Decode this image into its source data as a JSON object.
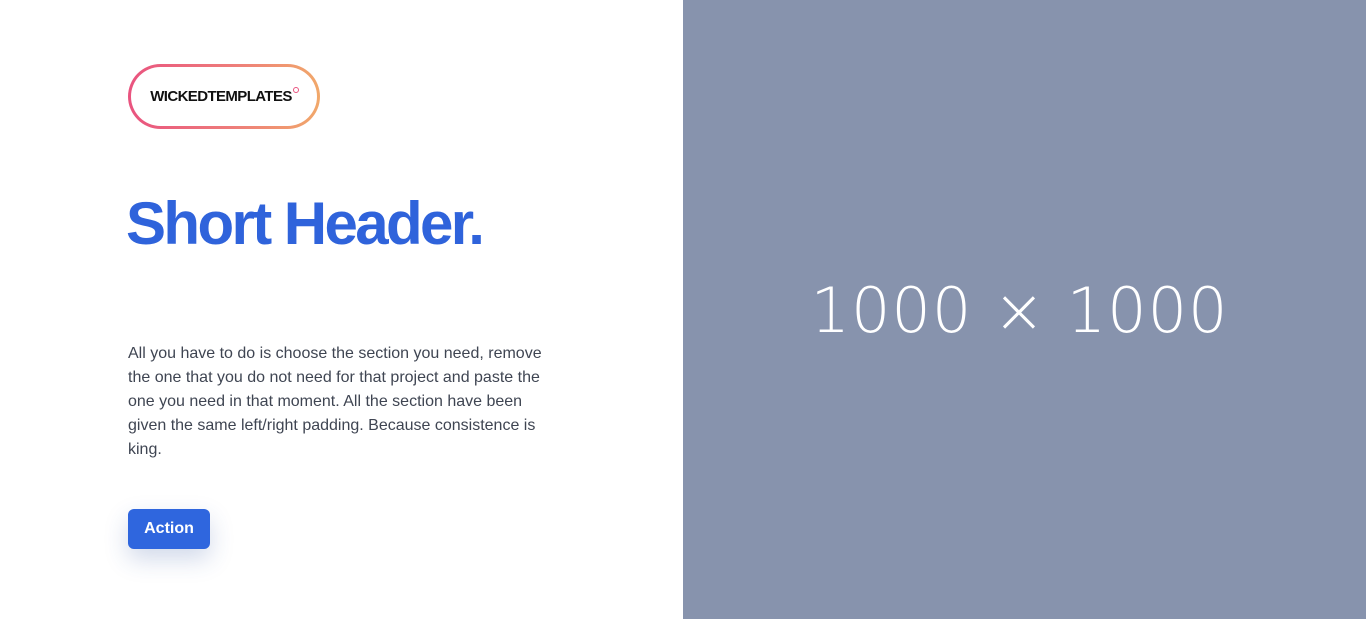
{
  "logo": {
    "text": "WICKEDTEMPLATES",
    "mark": "registered-mark-icon"
  },
  "hero": {
    "headline": "Short Header.",
    "body": "All you have to do is choose the section you need, remove the one that you do not need for that project and paste the one you need in that moment. All the section have been given the same left/right padding. Because consistence is king.",
    "action_label": "Action"
  },
  "image_placeholder": {
    "label": "1000 × 1000"
  },
  "colors": {
    "accent": "#2f63db",
    "button": "#2f66de",
    "placeholder_bg": "#8793ad",
    "logo_gradient_start": "#e9537f",
    "logo_gradient_end": "#f1a86a",
    "body_text": "#3f4552"
  }
}
